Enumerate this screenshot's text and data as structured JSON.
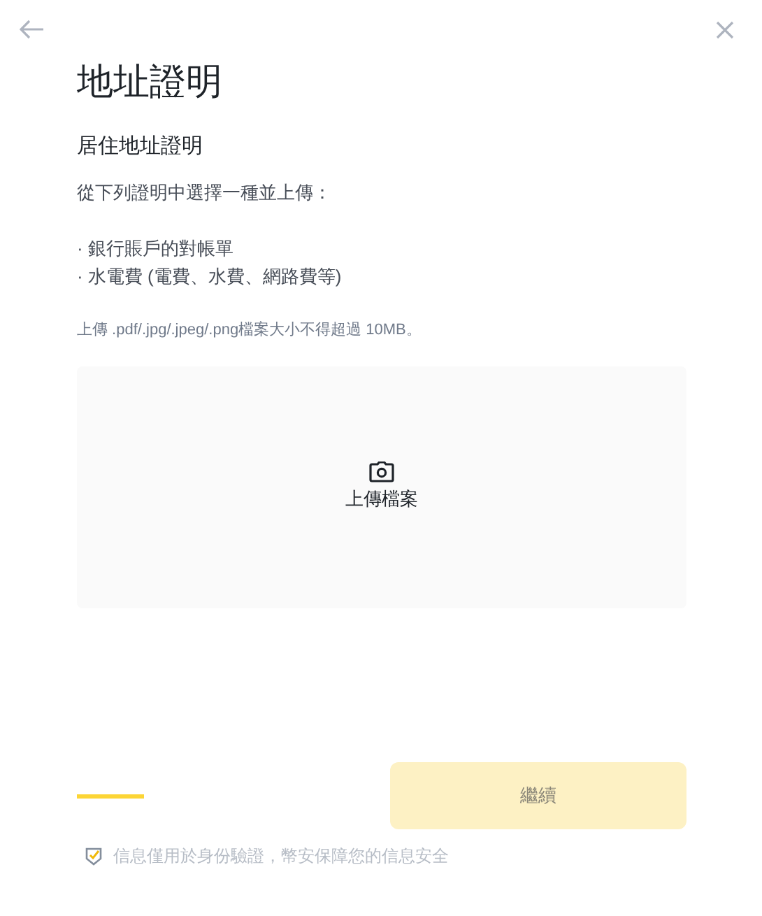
{
  "title": "地址證明",
  "subtitle": "居住地址證明",
  "instruction": "從下列證明中選擇一種並上傳：",
  "options": [
    "· 銀行賬戶的對帳單",
    "· 水電費 (電費、水費、網路費等)"
  ],
  "file_note": "上傳 .pdf/.jpg/.jpeg/.png檔案大小不得超過 10MB。",
  "upload": {
    "label": "上傳檔案"
  },
  "continue_button": {
    "label": "繼續",
    "disabled": true
  },
  "security_note": "信息僅用於身份驗證，幣安保障您的信息安全"
}
